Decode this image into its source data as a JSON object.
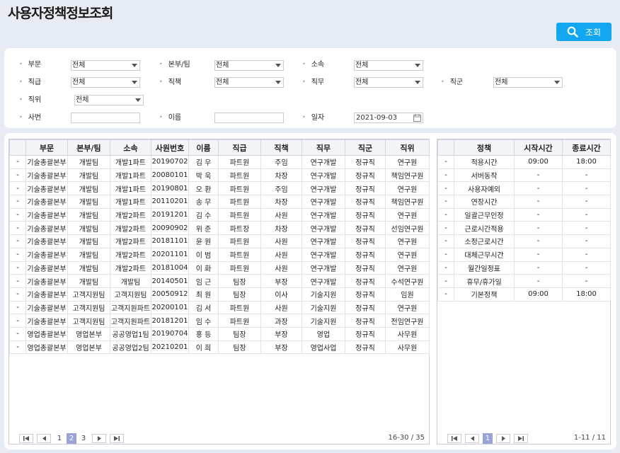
{
  "page": {
    "title": "사용자정책정보조회"
  },
  "toolbar": {
    "search_label": "조회"
  },
  "filters": {
    "dept_label": "부문",
    "dept_value": "전체",
    "team_label": "본부/팀",
    "team_value": "전체",
    "org_label": "소속",
    "org_value": "전체",
    "grade_label": "직급",
    "grade_value": "전체",
    "duty_label": "직책",
    "duty_value": "전체",
    "job_label": "직무",
    "job_value": "전체",
    "group_label": "직군",
    "group_value": "전체",
    "rank_label": "직위",
    "rank_value": "전체",
    "empno_label": "사번",
    "empno_value": "",
    "name_label": "이름",
    "name_value": "",
    "date_label": "일자",
    "date_value": "2021-09-03"
  },
  "users": {
    "columns": [
      "",
      "부문",
      "본부/팀",
      "소속",
      "사원번호",
      "이름",
      "직급",
      "직책",
      "직무",
      "직군",
      "직위"
    ],
    "rows": [
      [
        "-",
        "기술총괄본부",
        "개발팀",
        "개발1파트",
        "20190702",
        "김  우",
        "파트원",
        "주임",
        "연구개발",
        "정규직",
        "연구원"
      ],
      [
        "-",
        "기술총괄본부",
        "개발팀",
        "개발1파트",
        "20080101",
        "박  욱",
        "파트원",
        "차장",
        "연구개발",
        "정규직",
        "책임연구원"
      ],
      [
        "-",
        "기술총괄본부",
        "개발팀",
        "개발1파트",
        "20190801",
        "오  환",
        "파트원",
        "주임",
        "연구개발",
        "정규직",
        "연구원"
      ],
      [
        "-",
        "기술총괄본부",
        "개발팀",
        "개발1파트",
        "20110201",
        "송  무",
        "파트원",
        "차장",
        "연구개발",
        "정규직",
        "책임연구원"
      ],
      [
        "-",
        "기술총괄본부",
        "개발팀",
        "개발2파트",
        "20191201",
        "김  수",
        "파트원",
        "사원",
        "연구개발",
        "정규직",
        "연구원"
      ],
      [
        "-",
        "기술총괄본부",
        "개발팀",
        "개발2파트",
        "20090902",
        "위  준",
        "파트장",
        "차장",
        "연구개발",
        "정규직",
        "선임연구원"
      ],
      [
        "-",
        "기술총괄본부",
        "개발팀",
        "개발2파트",
        "20181101",
        "윤  원",
        "파트원",
        "사원",
        "연구개발",
        "정규직",
        "연구원"
      ],
      [
        "-",
        "기술총괄본부",
        "개발팀",
        "개발2파트",
        "20201101",
        "이  범",
        "파트원",
        "사원",
        "연구개발",
        "정규직",
        "연구원"
      ],
      [
        "-",
        "기술총괄본부",
        "개발팀",
        "개발2파트",
        "20181004",
        "이  화",
        "파트원",
        "사원",
        "연구개발",
        "정규직",
        "연구원"
      ],
      [
        "-",
        "기술총괄본부",
        "개발팀",
        "개발팀",
        "20140501",
        "임  근",
        "팀장",
        "부장",
        "연구개발",
        "정규직",
        "수석연구원"
      ],
      [
        "-",
        "기술총괄본부",
        "고객지원팀",
        "고객지원팀",
        "20050912",
        "최  원",
        "팀장",
        "이사",
        "기술지원",
        "정규직",
        "임원"
      ],
      [
        "-",
        "기술총괄본부",
        "고객지원팀",
        "고객지원파트",
        "20200101",
        "김  서",
        "파트원",
        "사원",
        "기술지원",
        "정규직",
        "연구원"
      ],
      [
        "-",
        "기술총괄본부",
        "고객지원팀",
        "고객지원파트",
        "20181201",
        "임  수",
        "파트원",
        "과장",
        "기술지원",
        "정규직",
        "전임연구원"
      ],
      [
        "-",
        "영업총괄본부",
        "영업본부",
        "공공영업1팀",
        "20190704",
        "홍  등",
        "팀장",
        "부장",
        "영업",
        "정규직",
        "사무원"
      ],
      [
        "-",
        "영업총괄본부",
        "영업본부",
        "공공영업2팀",
        "20210201",
        "이  희",
        "팀장",
        "부장",
        "영업사업",
        "정규직",
        "사무원"
      ]
    ],
    "pager": {
      "pages": [
        "1",
        "2",
        "3"
      ],
      "current": "2",
      "info": "16-30 / 35"
    }
  },
  "policies": {
    "columns": [
      "",
      "정책",
      "시작시간",
      "종료시간"
    ],
    "rows": [
      [
        "-",
        "적용시간",
        "09:00",
        "18:00"
      ],
      [
        "-",
        "서버동작",
        "-",
        "-"
      ],
      [
        "-",
        "사용자예외",
        "-",
        "-"
      ],
      [
        "-",
        "연장시간",
        "-",
        "-"
      ],
      [
        "-",
        "일괄근무인정",
        "-",
        "-"
      ],
      [
        "-",
        "근로시간적용",
        "-",
        "-"
      ],
      [
        "-",
        "소정근로시간",
        "-",
        "-"
      ],
      [
        "-",
        "대체근무시간",
        "-",
        "-"
      ],
      [
        "-",
        "월간일정표",
        "-",
        "-"
      ],
      [
        "-",
        "휴무/휴가일",
        "-",
        "-"
      ],
      [
        "-",
        "기본정책",
        "09:00",
        "18:00"
      ]
    ],
    "pager": {
      "pages": [
        "1"
      ],
      "current": "1",
      "info": "1-11 / 11"
    }
  }
}
